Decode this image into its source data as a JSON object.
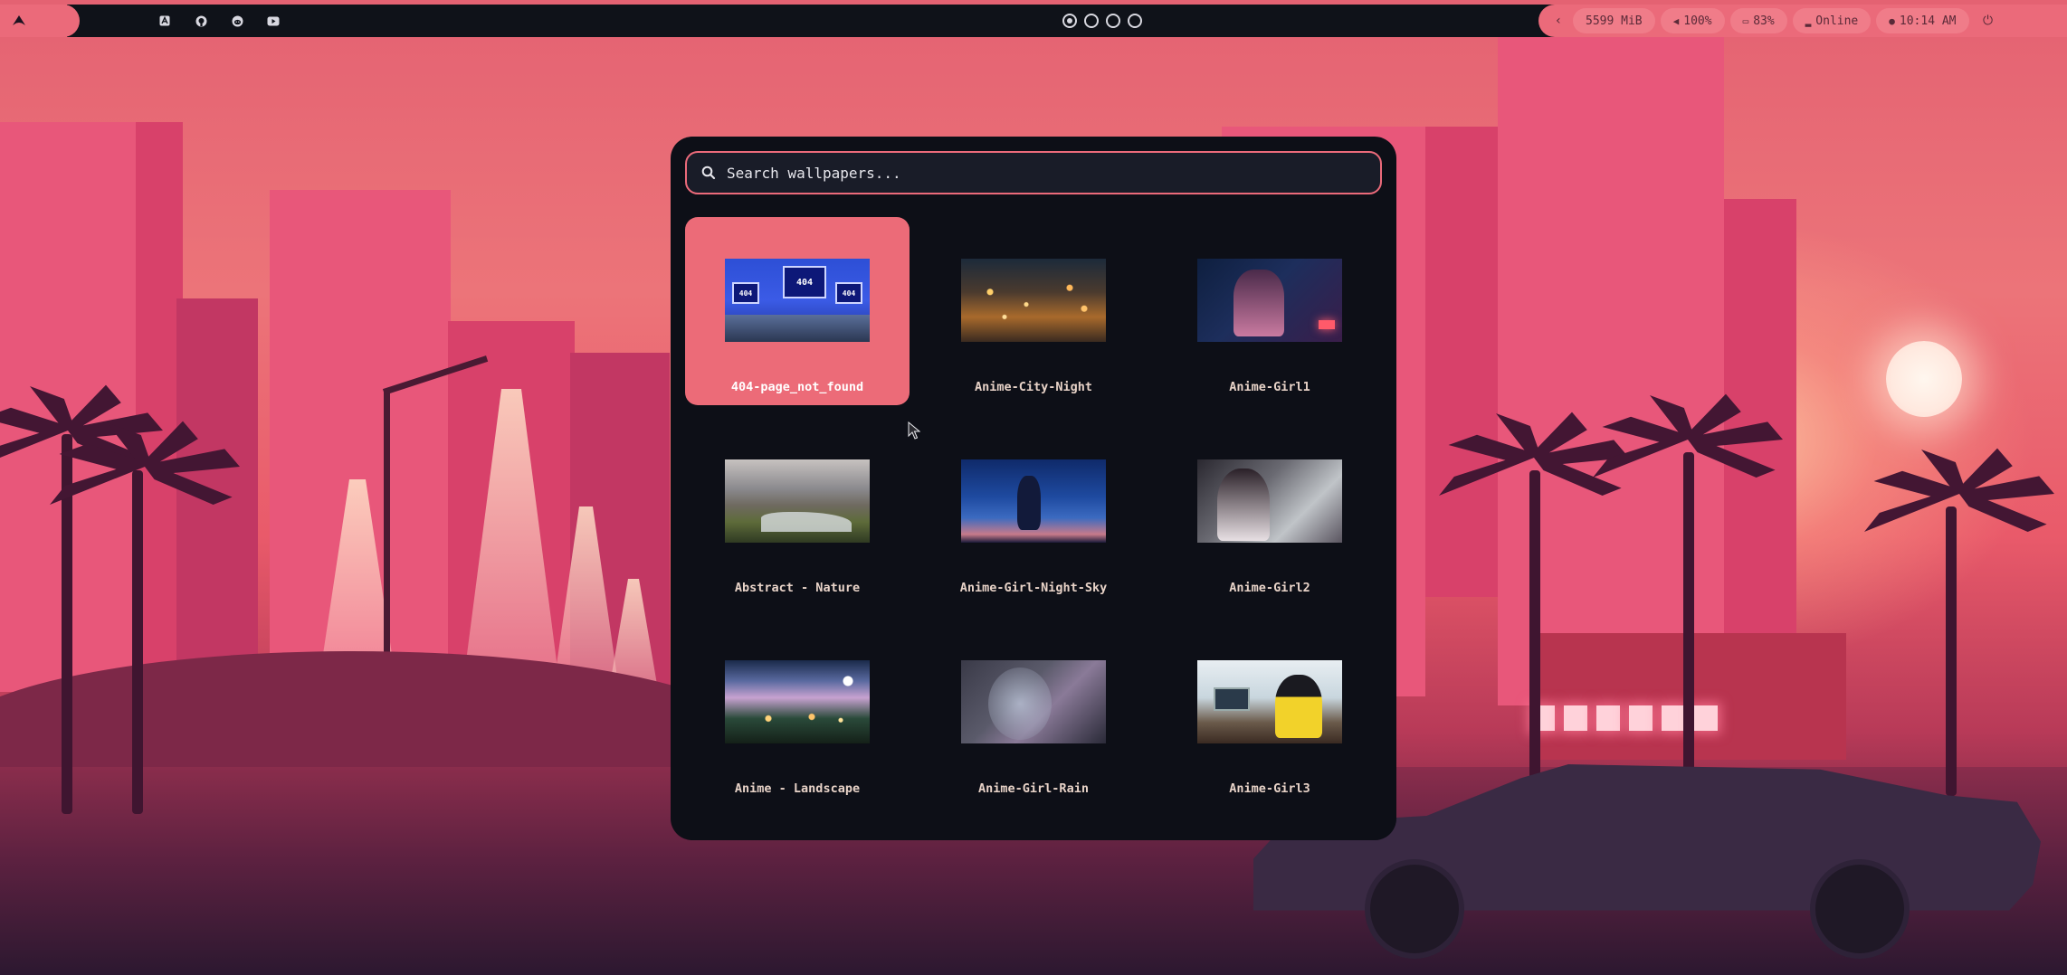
{
  "topbar": {
    "left_logo_icon": "arch-logo-icon",
    "apps": [
      {
        "name": "appstore-icon",
        "glyph": "A"
      },
      {
        "name": "github-icon",
        "glyph": "●"
      },
      {
        "name": "reddit-icon",
        "glyph": "☺"
      },
      {
        "name": "youtube-icon",
        "glyph": "▶"
      }
    ],
    "workspaces": [
      {
        "index": 1,
        "active": true
      },
      {
        "index": 2,
        "active": false
      },
      {
        "index": 3,
        "active": false
      },
      {
        "index": 4,
        "active": false
      }
    ],
    "tray_arrow": "‹",
    "memory": "5599 MiB",
    "volume": "100%",
    "battery": "83%",
    "network": "Online",
    "clock": "10:14 AM",
    "colors": {
      "accent": "#eb6a7a",
      "bar": "#0f1219"
    }
  },
  "launcher": {
    "search": {
      "placeholder": "Search wallpapers...",
      "value": ""
    },
    "wallpapers": [
      {
        "label": "404-page_not_found",
        "selected": true
      },
      {
        "label": "Anime-City-Night",
        "selected": false
      },
      {
        "label": "Anime-Girl1",
        "selected": false
      },
      {
        "label": "Abstract - Nature",
        "selected": false
      },
      {
        "label": "Anime-Girl-Night-Sky",
        "selected": false
      },
      {
        "label": "Anime-Girl2",
        "selected": false
      },
      {
        "label": "Anime - Landscape",
        "selected": false
      },
      {
        "label": "Anime-Girl-Rain",
        "selected": false
      },
      {
        "label": "Anime-Girl3",
        "selected": false
      }
    ],
    "thumb_404_text": "404"
  }
}
